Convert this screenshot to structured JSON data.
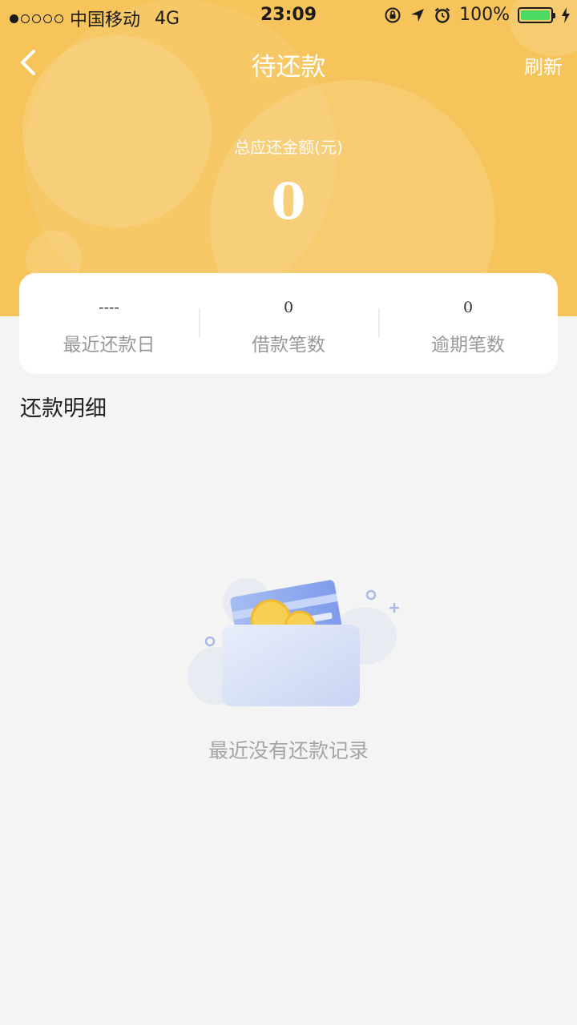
{
  "status_bar": {
    "carrier": "中国移动",
    "network": "4G",
    "time": "23:09",
    "battery": "100%",
    "battery_color": "#4cd964"
  },
  "nav": {
    "title": "待还款",
    "refresh_label": "刷新",
    "back_icon": "chevron-left-icon"
  },
  "total": {
    "label": "总应还金额(元)",
    "value": "0"
  },
  "summary": [
    {
      "value": "----",
      "label": "最近还款日"
    },
    {
      "value": "0",
      "label": "借款笔数"
    },
    {
      "value": "0",
      "label": "逾期笔数"
    }
  ],
  "section_title": "还款明细",
  "empty_state": {
    "message": "最近没有还款记录",
    "icon": "wallet-empty-icon"
  },
  "colors": {
    "header_bg": "#f6c45a",
    "page_bg": "#f4f4f4"
  }
}
